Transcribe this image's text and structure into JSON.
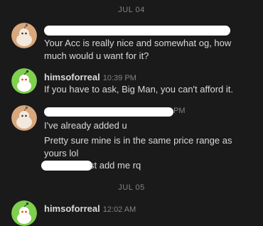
{
  "dates": {
    "first": "JUL 04",
    "second": "JUL 05"
  },
  "messages": [
    {
      "author": "",
      "time": "",
      "lines": [
        "Your Acc is really nice and somewhat og, how",
        "much would u want for it?"
      ]
    },
    {
      "author": "himsoforreal",
      "time": "10:39 PM",
      "lines": [
        "If you have to ask, Big Man, you can't afford it."
      ]
    },
    {
      "author": "",
      "time_fragment": "PM",
      "lines": [
        "I've already added u",
        "Pretty sure mine is in the same price range as",
        "yours lol"
      ],
      "redacted_line_tail": "st add me rq"
    },
    {
      "author": "himsoforreal",
      "time": "12:02 AM"
    }
  ],
  "colors": {
    "background": "#1a1a1b",
    "text": "#d7dadc",
    "muted": "#818384",
    "avatar_orange": "#d8a77b",
    "avatar_green": "#7fd04d"
  },
  "icons": {
    "user_avatar": "snoo-orange-avatar",
    "himso_avatar": "snoo-green-avatar"
  }
}
